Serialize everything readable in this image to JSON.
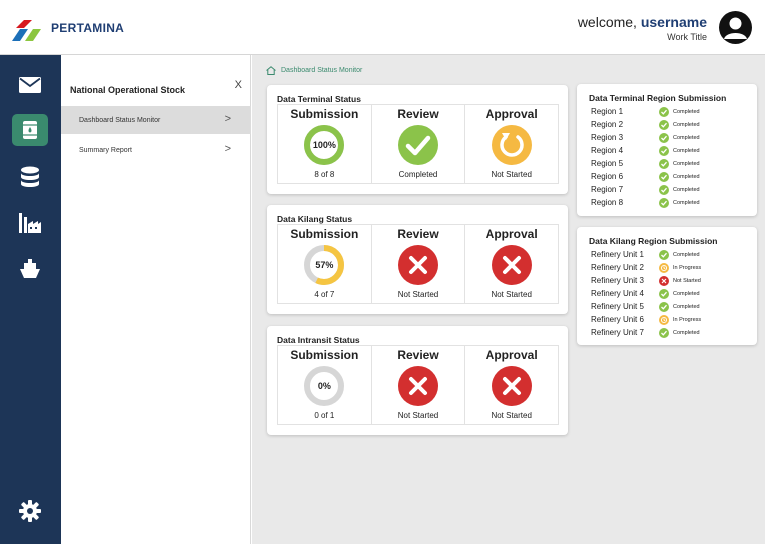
{
  "header": {
    "brand": "PERTAMINA",
    "welcome_prefix": "welcome,",
    "username": "username",
    "work_title": "Work Title"
  },
  "rail": {
    "items": [
      {
        "name": "mail-icon"
      },
      {
        "name": "oil-barrel-icon",
        "active": true
      },
      {
        "name": "database-icon"
      },
      {
        "name": "factory-icon"
      },
      {
        "name": "ship-icon"
      }
    ],
    "settings_icon": "gear-icon"
  },
  "sidebar": {
    "title": "National Operational Stock",
    "close": "X",
    "items": [
      {
        "label": "Dashboard Status Monitor",
        "chevron": ">",
        "active": true
      },
      {
        "label": "Summary Report",
        "chevron": ">"
      }
    ]
  },
  "breadcrumb": {
    "label": "Dashboard Status Monitor",
    "icon": "home-icon"
  },
  "colors": {
    "navy": "#1d3557",
    "accent_green": "#3a8a6e",
    "completed": "#8bc34a",
    "in_progress": "#f5b942",
    "not_started": "#d32f2f",
    "ring_track": "#d6d6d6"
  },
  "status_cards": [
    {
      "title": "Data Terminal Status",
      "submission": {
        "label": "Submission",
        "percent": "100%",
        "fraction": 1.0,
        "caption": "8 of 8",
        "color": "#8bc34a"
      },
      "review": {
        "label": "Review",
        "caption": "Completed",
        "state": "completed",
        "icon": "check-icon"
      },
      "approval": {
        "label": "Approval",
        "caption": "Not Started",
        "state": "pending",
        "icon": "refresh-icon"
      }
    },
    {
      "title": "Data Kilang Status",
      "submission": {
        "label": "Submission",
        "percent": "57%",
        "fraction": 0.57,
        "caption": "4 of 7",
        "color": "#f5c542"
      },
      "review": {
        "label": "Review",
        "caption": "Not Started",
        "state": "not-started",
        "icon": "x-icon"
      },
      "approval": {
        "label": "Approval",
        "caption": "Not Started",
        "state": "not-started",
        "icon": "x-icon"
      }
    },
    {
      "title": "Data Intransit Status",
      "submission": {
        "label": "Submission",
        "percent": "0%",
        "fraction": 0.0,
        "caption": "0 of 1",
        "color": "#d6d6d6"
      },
      "review": {
        "label": "Review",
        "caption": "Not Started",
        "state": "not-started",
        "icon": "x-icon"
      },
      "approval": {
        "label": "Approval",
        "caption": "Not Started",
        "state": "not-started",
        "icon": "x-icon"
      }
    }
  ],
  "region_cards": [
    {
      "title": "Data Terminal Region Submission",
      "rows": [
        {
          "name": "Region 1",
          "status": "Completed"
        },
        {
          "name": "Region 2",
          "status": "Completed"
        },
        {
          "name": "Region 3",
          "status": "Completed"
        },
        {
          "name": "Region 4",
          "status": "Completed"
        },
        {
          "name": "Region 5",
          "status": "Completed"
        },
        {
          "name": "Region 6",
          "status": "Completed"
        },
        {
          "name": "Region 7",
          "status": "Completed"
        },
        {
          "name": "Region 8",
          "status": "Completed"
        }
      ]
    },
    {
      "title": "Data Kilang Region Submission",
      "rows": [
        {
          "name": "Refinery Unit  1",
          "status": "Completed"
        },
        {
          "name": "Refinery Unit  2",
          "status": "In Progress"
        },
        {
          "name": "Refinery Unit  3",
          "status": "Not Started"
        },
        {
          "name": "Refinery Unit  4",
          "status": "Completed"
        },
        {
          "name": "Refinery Unit  5",
          "status": "Completed"
        },
        {
          "name": "Refinery Unit  6",
          "status": "In Progress"
        },
        {
          "name": "Refinery Unit  7",
          "status": "Completed"
        }
      ]
    }
  ]
}
